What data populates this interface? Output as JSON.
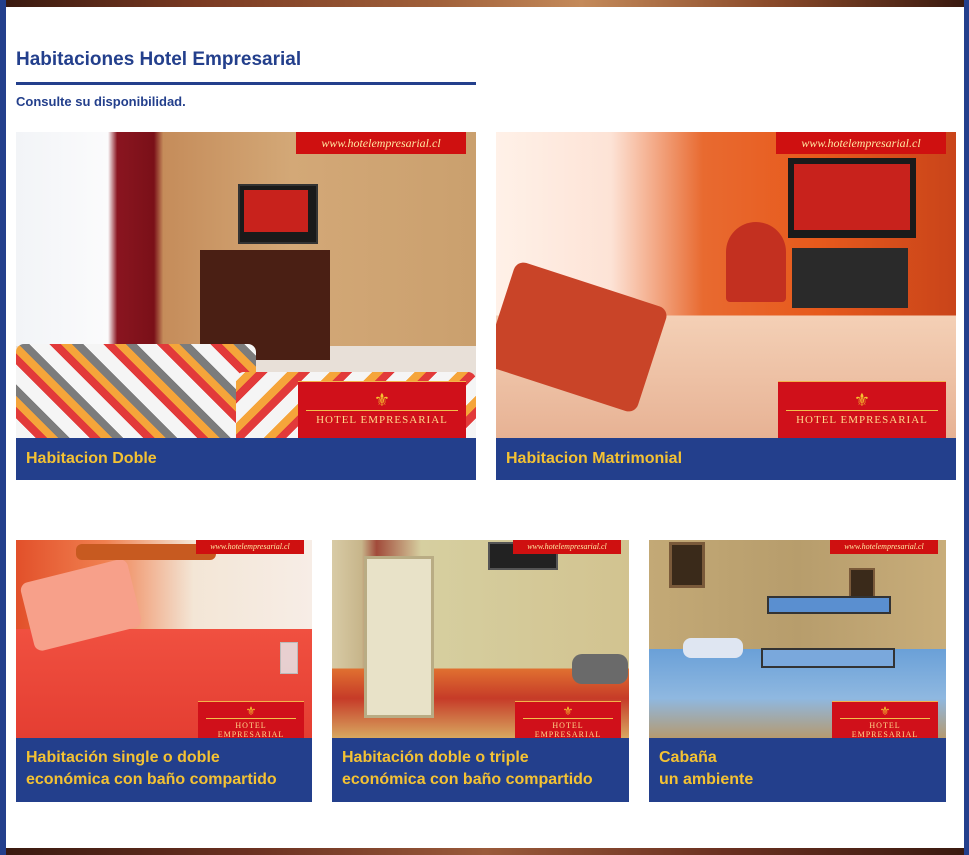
{
  "section": {
    "title": "Habitaciones Hotel Empresarial",
    "subtitle": "Consulte su disponibilidad."
  },
  "branding": {
    "url_text": "www.hotelempresarial.cl",
    "logo_text": "HOTEL EMPRESARIAL",
    "logo_glyph": "⚜"
  },
  "rooms": [
    {
      "caption": "Habitacion Doble",
      "caption_line2": ""
    },
    {
      "caption": "Habitacion Matrimonial",
      "caption_line2": ""
    },
    {
      "caption": "Habitación single o doble",
      "caption_line2": "económica con baño compartido"
    },
    {
      "caption": "Habitación doble o triple",
      "caption_line2": "económica con baño compartido"
    },
    {
      "caption": "Cabaña",
      "caption_line2": "un ambiente"
    }
  ],
  "colors": {
    "brand_blue": "#233f8c",
    "caption_text": "#f4c233",
    "logo_red": "#d0101a"
  }
}
